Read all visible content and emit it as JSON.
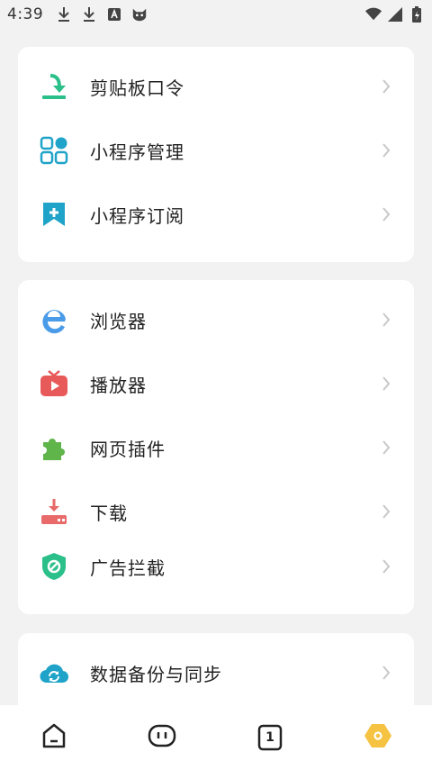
{
  "status_bar": {
    "time": "4:39",
    "icons_left": [
      "download-icon",
      "download-icon",
      "a-badge-icon",
      "cat-face-icon"
    ],
    "icons_right": [
      "wifi-icon",
      "signal-icon",
      "battery-charging-icon"
    ]
  },
  "group1": {
    "items": [
      {
        "label": "剪贴板口令",
        "icon": "clipboard-download-icon",
        "color": "#2bbf8a"
      },
      {
        "label": "小程序管理",
        "icon": "mini-program-grid-icon",
        "color": "#1fa3c8"
      },
      {
        "label": "小程序订阅",
        "icon": "bookmark-plus-icon",
        "color": "#1fa3c8"
      }
    ]
  },
  "group2": {
    "items": [
      {
        "label": "浏览器",
        "icon": "browser-e-icon",
        "color": "#4a9be8"
      },
      {
        "label": "播放器",
        "icon": "tv-play-icon",
        "color": "#e85a5a"
      },
      {
        "label": "网页插件",
        "icon": "puzzle-icon",
        "color": "#5fb44a"
      },
      {
        "label": "下载",
        "icon": "download-tray-icon",
        "color": "#e86a6a"
      },
      {
        "label": "广告拦截",
        "icon": "shield-block-icon",
        "color": "#2bbf8a"
      }
    ]
  },
  "group3": {
    "items": [
      {
        "label": "数据备份与同步",
        "icon": "cloud-sync-icon",
        "color": "#1fa3c8"
      }
    ]
  },
  "tab_bar": {
    "tabs": [
      {
        "name": "home-tab",
        "icon": "home-icon"
      },
      {
        "name": "robot-tab",
        "icon": "robot-face-icon"
      },
      {
        "name": "windows-tab",
        "icon": "tab-count-icon",
        "count": "1"
      },
      {
        "name": "profile-tab",
        "icon": "hexagon-icon",
        "color": "#f5c242"
      }
    ]
  }
}
